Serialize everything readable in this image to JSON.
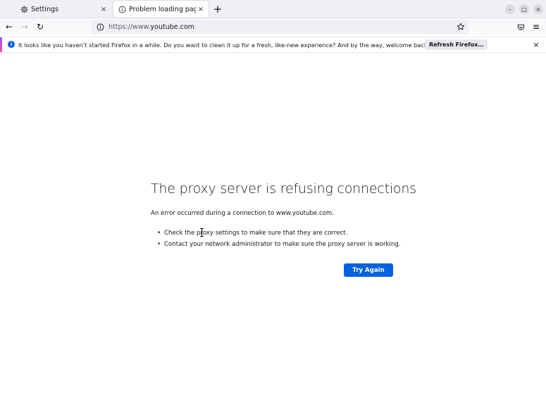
{
  "tabs": [
    {
      "label": "Settings",
      "icon": "gear-icon",
      "active": false
    },
    {
      "label": "Problem loading page",
      "icon": "info-icon",
      "active": true
    }
  ],
  "tab_close_glyph": "×",
  "new_tab_glyph": "+",
  "window_controls": {
    "minimize": "–",
    "maximize": "□",
    "close": "×"
  },
  "navbar": {
    "back_glyph": "←",
    "forward_glyph": "→",
    "reload_glyph": "↻",
    "url_prefix": "https://www.",
    "url_host": "youtube.com",
    "pocket_icon": "pocket-icon",
    "menu_glyph": "≡"
  },
  "notification": {
    "message": "It looks like you haven’t started Firefox in a while. Do you want to clean it up for a fresh, like-new experience? And by the way, welcome back!",
    "button_label": "Refresh Firefox…",
    "close_glyph": "×"
  },
  "error": {
    "title": "The proxy server is refusing connections",
    "description": "An error occurred during a connection to www.youtube.com.",
    "bullets": [
      "Check the proxy settings to make sure that they are correct.",
      "Contact your network administrator to make sure the proxy server is working."
    ],
    "try_again_label": "Try Again"
  },
  "colors": {
    "accent_blue": "#0061e0",
    "tabstrip_bg": "#f0f0f4",
    "page_bg": "#ffffff"
  }
}
